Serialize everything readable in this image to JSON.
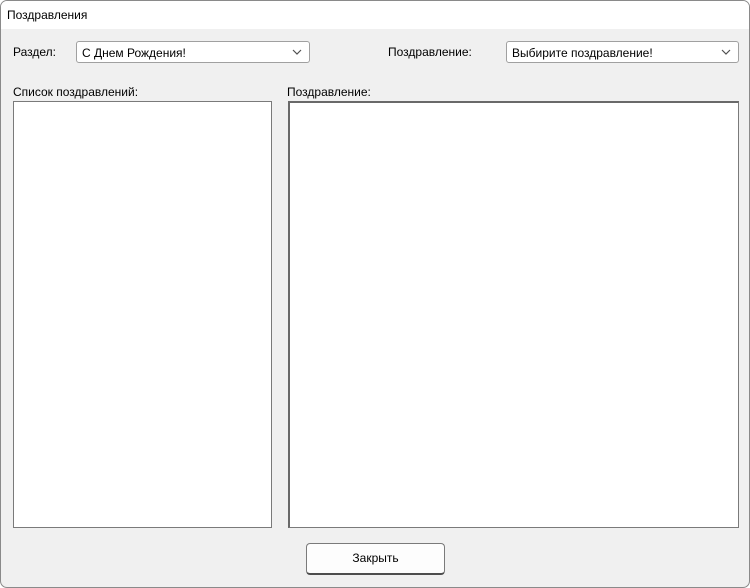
{
  "window": {
    "title": "Поздравления"
  },
  "section": {
    "label": "Раздел:",
    "value": "С Днем Рождения!"
  },
  "greeting_select": {
    "label": "Поздравление:",
    "value": "Выбирите поздравление!"
  },
  "list_panel": {
    "label": "Список поздравлений:"
  },
  "text_panel": {
    "label": "Поздравление:"
  },
  "buttons": {
    "close_label": "Закрыть"
  },
  "icons": {
    "dropdown": "chevron-down-icon"
  }
}
